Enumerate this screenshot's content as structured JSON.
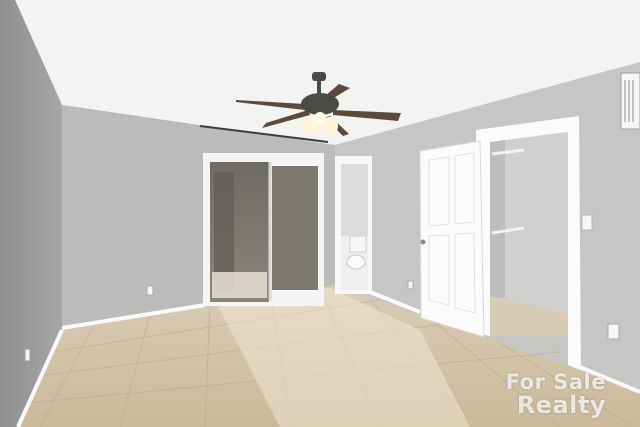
{
  "photo": {
    "subject": "vacant-bedroom-interior",
    "colors": {
      "ceiling": "#f4f4f3",
      "wall_left": "#9c9c9a",
      "wall_back": "#bcbcba",
      "wall_right": "#c7c7c5",
      "floor": "#d8c9ae",
      "trim": "#ffffff",
      "fan_body": "#4d4b48",
      "fan_blades": "#5c4a3f"
    },
    "icons": [
      "ceiling-fan-icon",
      "vent-icon",
      "light-switch-icon",
      "outlet-icon"
    ]
  },
  "watermark": {
    "line1": "For Sale",
    "line2": "Realty"
  }
}
